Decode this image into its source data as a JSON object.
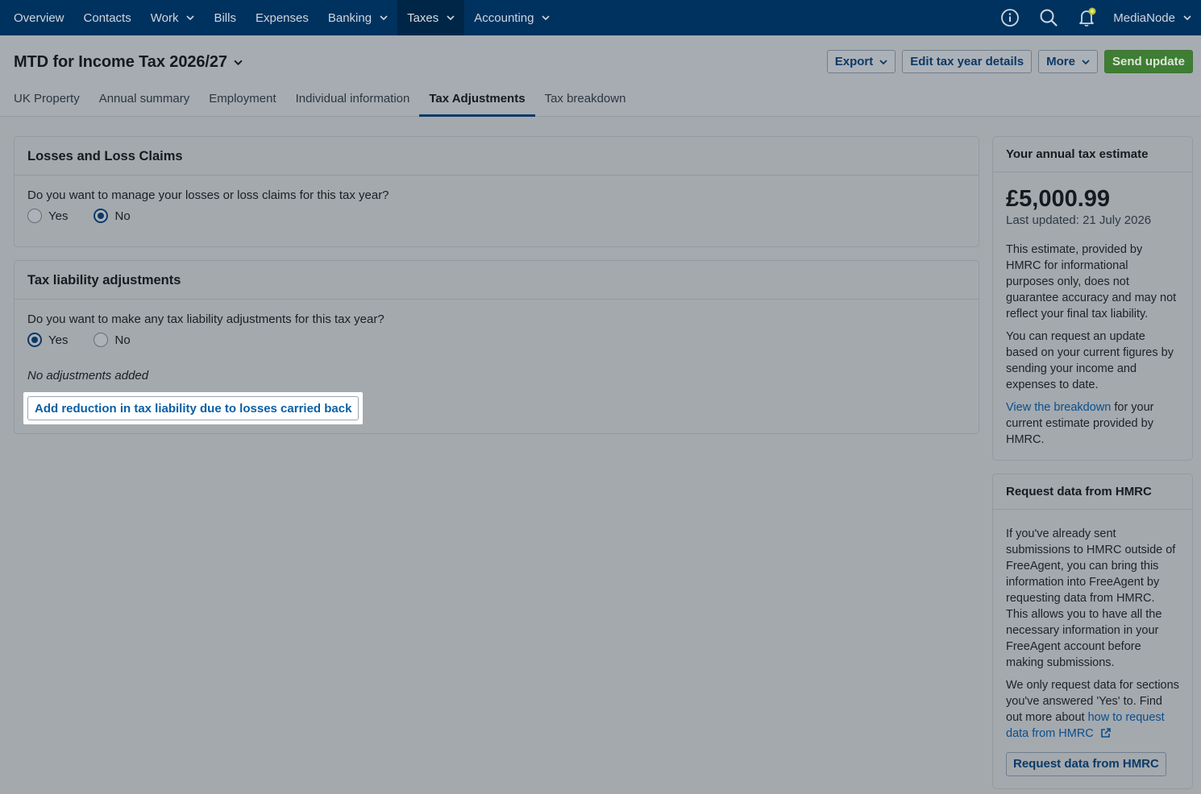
{
  "nav": {
    "items": [
      {
        "label": "Overview"
      },
      {
        "label": "Contacts"
      },
      {
        "label": "Work"
      },
      {
        "label": "Bills"
      },
      {
        "label": "Expenses"
      },
      {
        "label": "Banking"
      },
      {
        "label": "Taxes"
      },
      {
        "label": "Accounting"
      }
    ],
    "user": "MediaNode",
    "icons": [
      "info-icon",
      "search-icon",
      "bell-icon"
    ]
  },
  "header": {
    "title": "MTD for Income Tax 2026/27",
    "buttons": {
      "export": "Export",
      "edit": "Edit tax year details",
      "more": "More",
      "send": "Send update"
    },
    "tabs": [
      {
        "label": "UK Property"
      },
      {
        "label": "Annual summary"
      },
      {
        "label": "Employment"
      },
      {
        "label": "Individual information"
      },
      {
        "label": "Tax Adjustments"
      },
      {
        "label": "Tax breakdown"
      }
    ]
  },
  "losses": {
    "title": "Losses and Loss Claims",
    "question": "Do you want to manage your losses or loss claims for this tax year?",
    "yes": "Yes",
    "no": "No",
    "selected": "No"
  },
  "liability": {
    "title": "Tax liability adjustments",
    "question": "Do you want to make any tax liability adjustments for this tax year?",
    "yes": "Yes",
    "no": "No",
    "selected": "Yes",
    "empty": "No adjustments added",
    "add_button": "Add reduction in tax liability due to losses carried back"
  },
  "estimate": {
    "title": "Your annual tax estimate",
    "amount": "£5,000.99",
    "updated": "Last updated: 21 July 2026",
    "p1": "This estimate, provided by HMRC for informational purposes only, does not guarantee accuracy and may not reflect your final tax liability.",
    "p2": "You can request an update based on your current figures by sending your income and expenses to date.",
    "p3_link": "View the breakdown",
    "p3_rest": " for your current estimate provided by HMRC."
  },
  "request": {
    "title": "Request data from HMRC",
    "p1": "If you've already sent submissions to HMRC outside of FreeAgent, you can bring this information into FreeAgent by requesting data from HMRC. This allows you to have all the necessary information in your FreeAgent account before making submissions.",
    "p2_text": "We only request data for sections you've answered 'Yes' to. Find out more about ",
    "p2_link": "how to request data from HMRC",
    "button": "Request data from HMRC"
  },
  "colors": {
    "nav_bg": "#00325f",
    "primary_green": "#3f7d34",
    "link_blue": "#0b5fa5"
  }
}
